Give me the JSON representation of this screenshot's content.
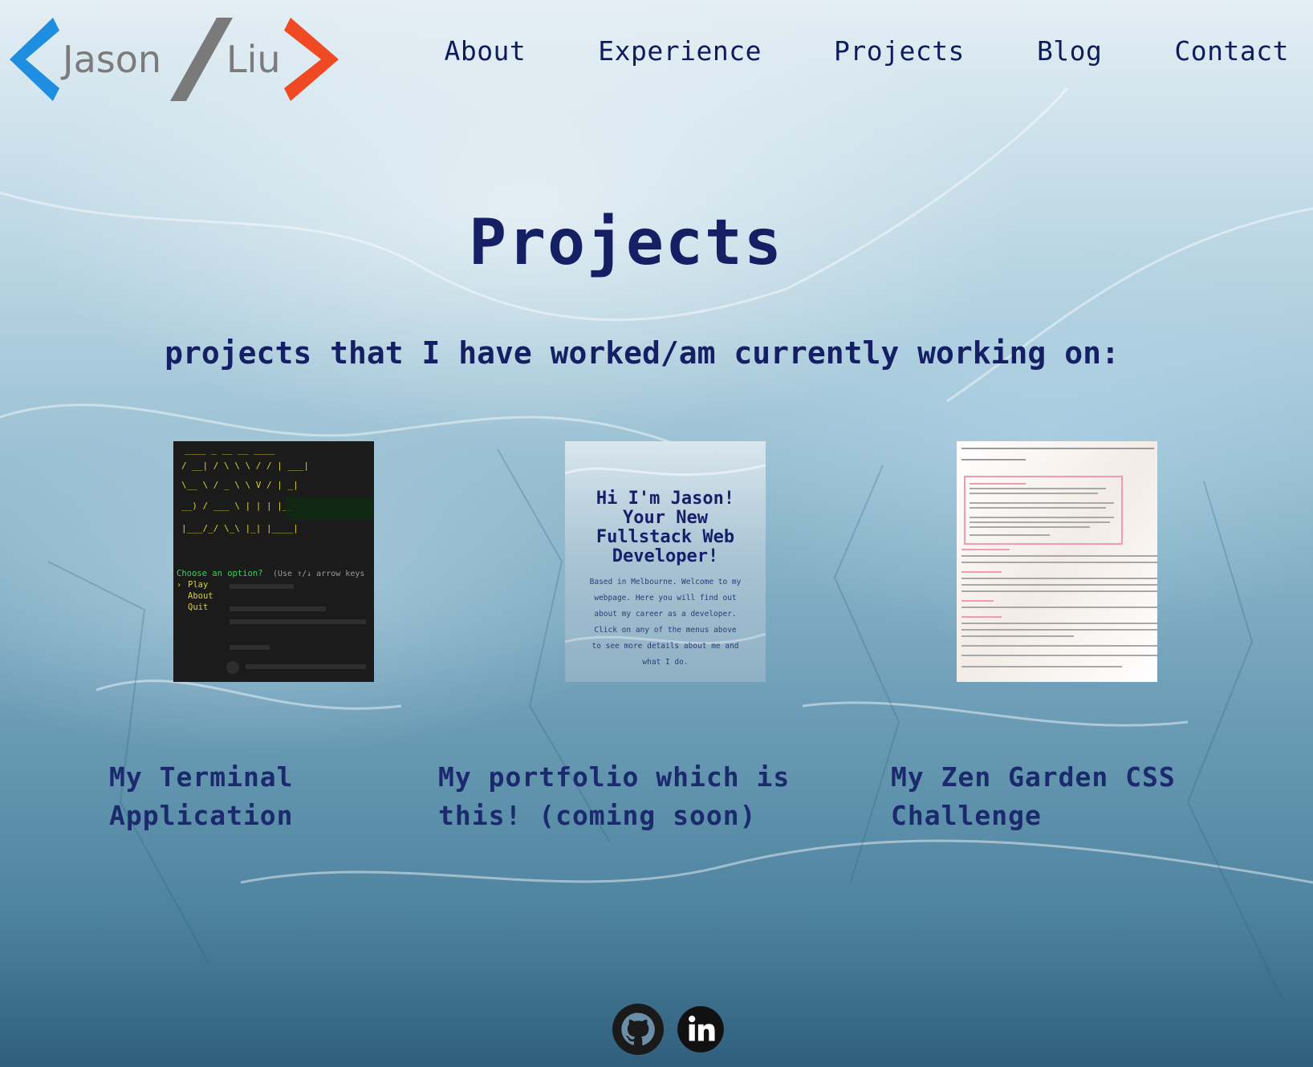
{
  "brand": {
    "first_name": "Jason",
    "last_name": "Liu",
    "colors": {
      "left_bracket": "#1f8de0",
      "slash": "#7a7a7a",
      "right_bracket": "#ef4a24"
    }
  },
  "nav": {
    "items": [
      {
        "label": "About"
      },
      {
        "label": "Experience"
      },
      {
        "label": "Projects"
      },
      {
        "label": "Blog"
      },
      {
        "label": "Contact"
      }
    ]
  },
  "page": {
    "title": "Projects",
    "subtitle": "projects that I have worked/am currently working on:"
  },
  "projects": [
    {
      "title": "My Terminal Application",
      "thumbnail": {
        "prompt_label": "Choose an option?",
        "prompt_hint": "(Use ↑/↓ arrow keys",
        "options": [
          "Play",
          "About",
          "Quit"
        ]
      }
    },
    {
      "title": "My portfolio which is this! (coming soon)",
      "thumbnail": {
        "headline": "Hi I'm Jason! Your New Fullstack Web Developer!",
        "body": "Based in Melbourne. Welcome to my webpage. Here you will find out about my career as a developer. Click on any of the menus above to see more details about me and what I do."
      }
    },
    {
      "title": "My Zen Garden CSS Challenge"
    }
  ],
  "social": [
    {
      "icon": "github-icon"
    },
    {
      "icon": "linkedin-icon"
    }
  ]
}
